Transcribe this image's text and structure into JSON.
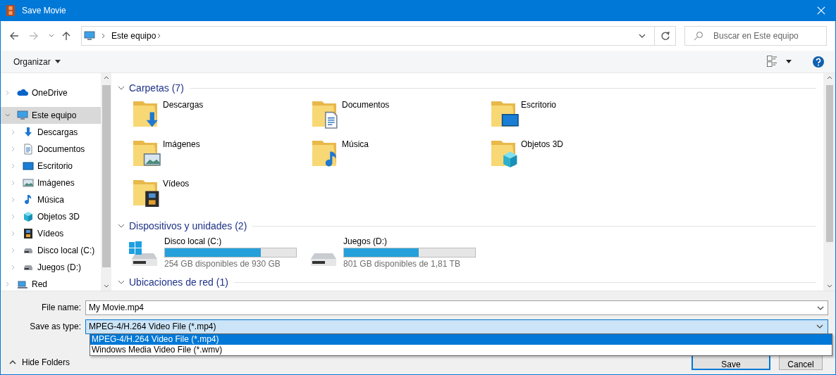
{
  "window": {
    "title": "Save Movie"
  },
  "nav": {
    "breadcrumb": [
      {
        "label": "Este equipo"
      }
    ],
    "search": {
      "placeholder": "Buscar en Este equipo"
    }
  },
  "toolbar": {
    "organize": "Organizar"
  },
  "sidebar": {
    "items": [
      {
        "label": "OneDrive",
        "kind": "cloud",
        "expanded": false,
        "selected": false
      },
      {
        "label": "Este equipo",
        "kind": "pc",
        "expanded": true,
        "selected": true,
        "children": [
          {
            "label": "Descargas",
            "kind": "downloads",
            "expanded": false,
            "selected": false
          },
          {
            "label": "Documentos",
            "kind": "documents",
            "expanded": false,
            "selected": false
          },
          {
            "label": "Escritorio",
            "kind": "desktop",
            "expanded": false,
            "selected": false
          },
          {
            "label": "Imágenes",
            "kind": "pictures",
            "expanded": false,
            "selected": false
          },
          {
            "label": "Música",
            "kind": "music",
            "expanded": false,
            "selected": false
          },
          {
            "label": "Objetos 3D",
            "kind": "objects3d",
            "expanded": false,
            "selected": false
          },
          {
            "label": "Vídeos",
            "kind": "videos",
            "expanded": false,
            "selected": false
          },
          {
            "label": "Disco local (C:)",
            "kind": "drive",
            "expanded": false,
            "selected": false
          },
          {
            "label": "Juegos (D:)",
            "kind": "drive",
            "expanded": false,
            "selected": false
          }
        ]
      },
      {
        "label": "Red",
        "kind": "network",
        "expanded": false,
        "selected": false
      }
    ]
  },
  "groups": [
    {
      "title": "Carpetas (7)",
      "expanded": true,
      "kind": "folders",
      "items": [
        {
          "name": "Descargas",
          "kind": "downloads"
        },
        {
          "name": "Documentos",
          "kind": "documents"
        },
        {
          "name": "Escritorio",
          "kind": "desktop"
        },
        {
          "name": "Imágenes",
          "kind": "pictures"
        },
        {
          "name": "Música",
          "kind": "music"
        },
        {
          "name": "Objetos 3D",
          "kind": "objects3d"
        },
        {
          "name": "Vídeos",
          "kind": "videos"
        }
      ]
    },
    {
      "title": "Dispositivos y unidades (2)",
      "expanded": true,
      "kind": "drives",
      "items": [
        {
          "name": "Disco local (C:)",
          "kind": "system",
          "level": 0.73,
          "free": "254 GB disponibles de 930 GB"
        },
        {
          "name": "Juegos (D:)",
          "kind": "plain",
          "level": 0.57,
          "free": "801 GB disponibles de 1,81 TB"
        }
      ]
    },
    {
      "title": "Ubicaciones de red (1)",
      "expanded": true,
      "kind": "network"
    }
  ],
  "form": {
    "file_name": {
      "label": "File name:",
      "value": "My Movie.mp4"
    },
    "save_type": {
      "label": "Save as type:",
      "value": "MPEG-4/H.264 Video File (*.mp4)",
      "expanded": true,
      "options": [
        {
          "label": "MPEG-4/H.264 Video File (*.mp4)",
          "selected": true
        },
        {
          "label": "Windows Media Video File (*.wmv)",
          "selected": false
        }
      ]
    }
  },
  "footer": {
    "hide_folders": "Hide Folders",
    "buttons": [
      {
        "label": "Save",
        "default": true
      },
      {
        "label": "Cancel",
        "default": false
      }
    ]
  }
}
